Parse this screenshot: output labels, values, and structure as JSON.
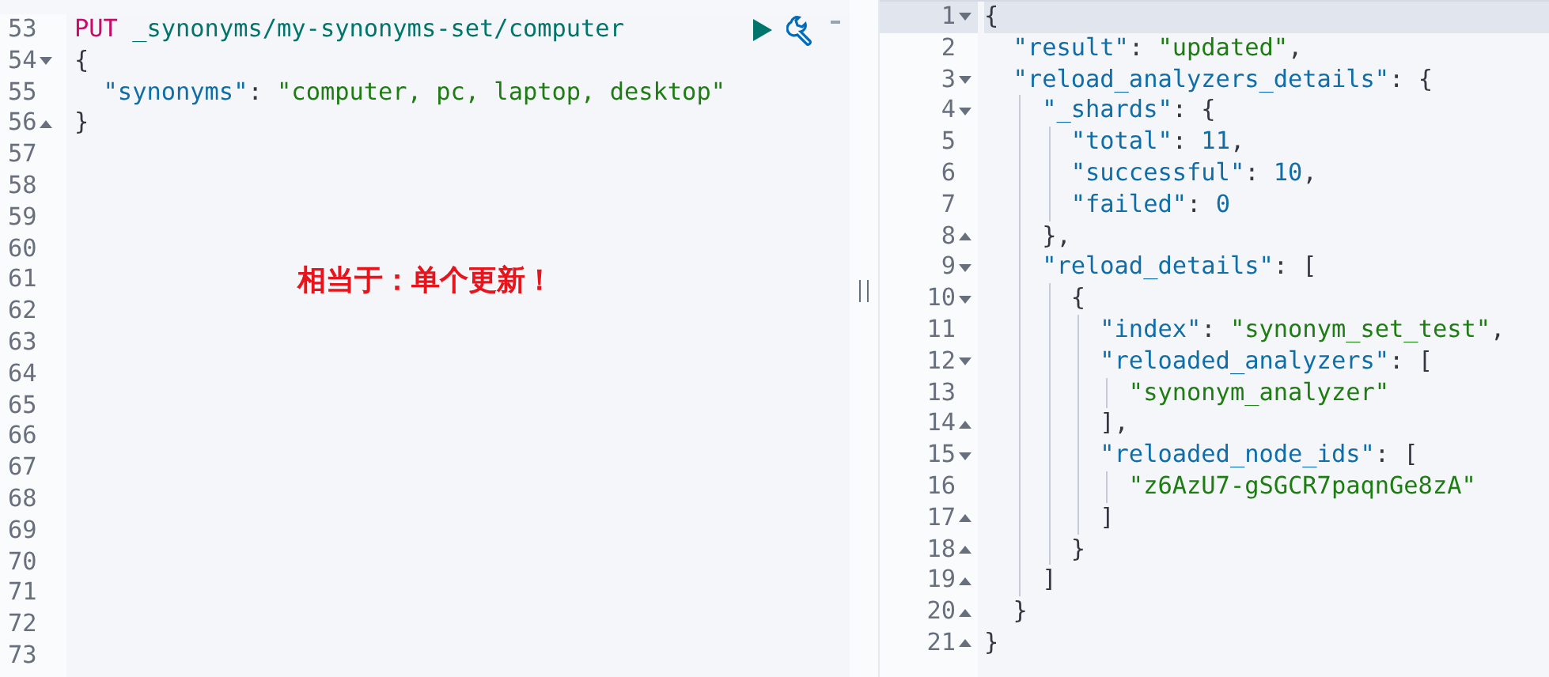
{
  "request_editor": {
    "lines": [
      {
        "number": "53",
        "tokens": [
          {
            "kind": "method",
            "text": "PUT"
          },
          {
            "kind": "url",
            "text": " _synonyms/my-synonyms-set/computer"
          }
        ]
      },
      {
        "number": "54",
        "kind": "fold_start",
        "tokens": [
          {
            "kind": "punct",
            "text": "{"
          }
        ]
      },
      {
        "number": "55",
        "tokens": [
          {
            "kind": "key",
            "text": "  \"synonyms\""
          },
          {
            "kind": "punct",
            "text": ": "
          },
          {
            "kind": "string",
            "text": "\"computer, pc, laptop, desktop\""
          }
        ]
      },
      {
        "number": "56",
        "kind": "fold_end",
        "tokens": [
          {
            "kind": "punct",
            "text": "}"
          }
        ]
      },
      {
        "number": "57"
      },
      {
        "number": "58"
      },
      {
        "number": "59"
      },
      {
        "number": "60"
      },
      {
        "number": "61"
      },
      {
        "number": "62"
      },
      {
        "number": "63"
      },
      {
        "number": "64"
      },
      {
        "number": "65"
      },
      {
        "number": "66"
      },
      {
        "number": "67"
      },
      {
        "number": "68"
      },
      {
        "number": "69"
      },
      {
        "number": "70"
      },
      {
        "number": "71"
      },
      {
        "number": "72"
      },
      {
        "number": "73"
      }
    ],
    "annotation": "相当于：单个更新！"
  },
  "response_editor": {
    "lines": [
      {
        "number": "1",
        "kind": "fold_start",
        "tokens": [
          {
            "kind": "punct",
            "text": "{"
          }
        ]
      },
      {
        "number": "2",
        "tokens": [
          {
            "kind": "key",
            "text": "  \"result\""
          },
          {
            "kind": "punct",
            "text": ": "
          },
          {
            "kind": "string",
            "text": "\"updated\""
          },
          {
            "kind": "punct",
            "text": ","
          }
        ]
      },
      {
        "number": "3",
        "kind": "fold_start",
        "tokens": [
          {
            "kind": "key",
            "text": "  \"reload_analyzers_details\""
          },
          {
            "kind": "punct",
            "text": ": {"
          }
        ]
      },
      {
        "number": "4",
        "kind": "fold_start",
        "tokens": [
          {
            "kind": "key",
            "text": "    \"_shards\""
          },
          {
            "kind": "punct",
            "text": ": {"
          }
        ]
      },
      {
        "number": "5",
        "tokens": [
          {
            "kind": "key",
            "text": "      \"total\""
          },
          {
            "kind": "punct",
            "text": ": "
          },
          {
            "kind": "number",
            "text": "11"
          },
          {
            "kind": "punct",
            "text": ","
          }
        ]
      },
      {
        "number": "6",
        "tokens": [
          {
            "kind": "key",
            "text": "      \"successful\""
          },
          {
            "kind": "punct",
            "text": ": "
          },
          {
            "kind": "number",
            "text": "10"
          },
          {
            "kind": "punct",
            "text": ","
          }
        ]
      },
      {
        "number": "7",
        "tokens": [
          {
            "kind": "key",
            "text": "      \"failed\""
          },
          {
            "kind": "punct",
            "text": ": "
          },
          {
            "kind": "number",
            "text": "0"
          }
        ]
      },
      {
        "number": "8",
        "kind": "fold_end",
        "tokens": [
          {
            "kind": "punct",
            "text": "    },"
          }
        ]
      },
      {
        "number": "9",
        "kind": "fold_start",
        "tokens": [
          {
            "kind": "key",
            "text": "    \"reload_details\""
          },
          {
            "kind": "punct",
            "text": ": ["
          }
        ]
      },
      {
        "number": "10",
        "kind": "fold_start",
        "tokens": [
          {
            "kind": "punct",
            "text": "      {"
          }
        ]
      },
      {
        "number": "11",
        "tokens": [
          {
            "kind": "key",
            "text": "        \"index\""
          },
          {
            "kind": "punct",
            "text": ": "
          },
          {
            "kind": "string",
            "text": "\"synonym_set_test\""
          },
          {
            "kind": "punct",
            "text": ","
          }
        ]
      },
      {
        "number": "12",
        "kind": "fold_start",
        "tokens": [
          {
            "kind": "key",
            "text": "        \"reloaded_analyzers\""
          },
          {
            "kind": "punct",
            "text": ": ["
          }
        ]
      },
      {
        "number": "13",
        "tokens": [
          {
            "kind": "string",
            "text": "          \"synonym_analyzer\""
          }
        ]
      },
      {
        "number": "14",
        "kind": "fold_end",
        "tokens": [
          {
            "kind": "punct",
            "text": "        ],"
          }
        ]
      },
      {
        "number": "15",
        "kind": "fold_start",
        "tokens": [
          {
            "kind": "key",
            "text": "        \"reloaded_node_ids\""
          },
          {
            "kind": "punct",
            "text": ": ["
          }
        ]
      },
      {
        "number": "16",
        "tokens": [
          {
            "kind": "string",
            "text": "          \"z6AzU7-gSGCR7paqnGe8zA\""
          }
        ]
      },
      {
        "number": "17",
        "kind": "fold_end",
        "tokens": [
          {
            "kind": "punct",
            "text": "        ]"
          }
        ]
      },
      {
        "number": "18",
        "kind": "fold_end",
        "tokens": [
          {
            "kind": "punct",
            "text": "      }"
          }
        ]
      },
      {
        "number": "19",
        "kind": "fold_end",
        "tokens": [
          {
            "kind": "punct",
            "text": "    ]"
          }
        ]
      },
      {
        "number": "20",
        "kind": "fold_end",
        "tokens": [
          {
            "kind": "punct",
            "text": "  }"
          }
        ]
      },
      {
        "number": "21",
        "kind": "fold_end",
        "tokens": [
          {
            "kind": "punct",
            "text": "}"
          }
        ]
      }
    ]
  }
}
